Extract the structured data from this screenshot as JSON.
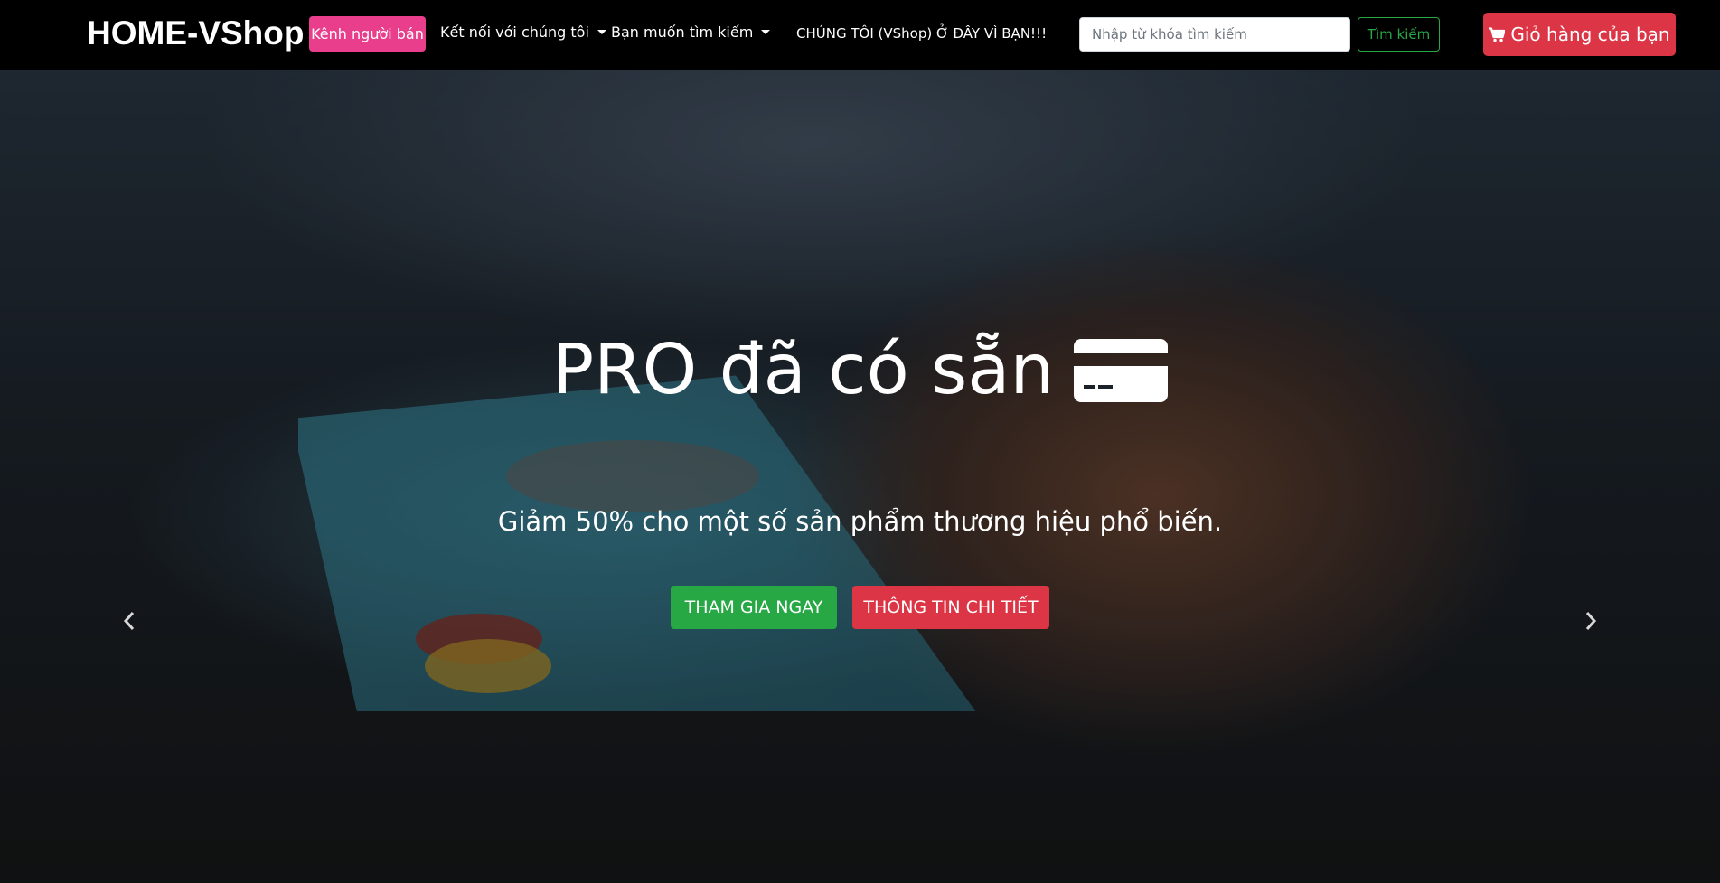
{
  "navbar": {
    "brand": "HOME-VShop",
    "seller_channel": "Kênh người bán",
    "connect_menu": "Kết nối với chúng tôi",
    "search_menu": "Bạn muốn tìm kiếm",
    "tagline": "CHÚNG TÔI (VShop) Ở ĐÂY VÌ BẠN!!!",
    "search": {
      "placeholder": "Nhập từ khóa tìm kiếm",
      "value": "",
      "button": "Tìm kiếm"
    },
    "cart_button": "Giỏ hàng của bạn",
    "cart_icon": "shopping-cart-icon"
  },
  "hero": {
    "title": "PRO đã có sẵn",
    "title_icon": "credit-card-icon",
    "subtitle": "Giảm 50% cho một số sản phẩm thương hiệu phổ biến.",
    "join_button": "THAM GIA NGAY",
    "info_button": "THÔNG TIN CHI TIẾT",
    "prev_icon": "chevron-left-icon",
    "next_icon": "chevron-right-icon"
  },
  "colors": {
    "navbar_bg": "#000000",
    "seller_btn": "#e83e8c",
    "success": "#28a745",
    "danger": "#dc3545"
  }
}
